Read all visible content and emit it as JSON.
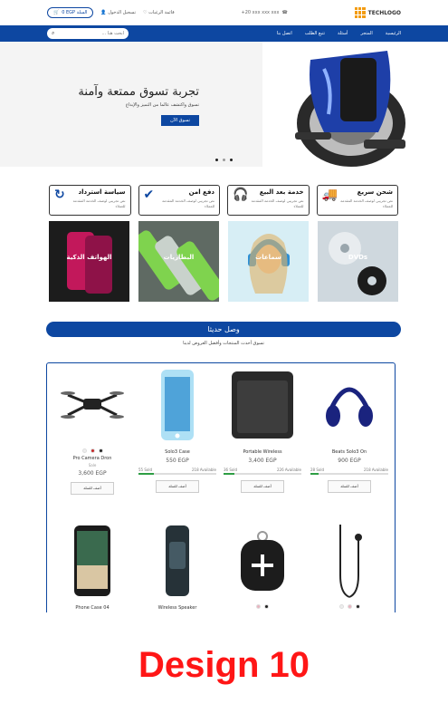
{
  "topbar": {
    "logo_text": "TECHLOGO",
    "contact": "+20 xxx xxx xxx",
    "wishlist": "قائمة الرغبات",
    "login": "تسجيل الدخول",
    "cart": "0 EGP السلة"
  },
  "nav": {
    "items": [
      {
        "label": "الرئيسية"
      },
      {
        "label": "المتجر"
      },
      {
        "label": "أسئلة"
      },
      {
        "label": "تتبع الطلب"
      },
      {
        "label": "اتصل بنا"
      }
    ],
    "search_placeholder": "ابحث هنا ..."
  },
  "hero": {
    "title": "تجربة تسوق ممتعة وآمنة",
    "subtitle": "تسوق واكتشف عالما من التميز والإبداع",
    "button": "تسوق الآن"
  },
  "features": [
    {
      "title": "شحن سريع",
      "desc": "نص تجريبي لوصف الخدمة المقدمة للعملاء"
    },
    {
      "title": "خدمة بعد البيع",
      "desc": "نص تجريبي لوصف الخدمة المقدمة للعملاء"
    },
    {
      "title": "دفع امن",
      "desc": "نص تجريبي لوصف الخدمة المقدمة للعملاء"
    },
    {
      "title": "سياسة استرداد",
      "desc": "نص تجريبي لوصف الخدمة المقدمة للعملاء"
    }
  ],
  "promos": [
    {
      "label": "الهواتف الذكية"
    },
    {
      "label": "البطاريات"
    },
    {
      "label": "سماعات"
    },
    {
      "label": "DVDs"
    }
  ],
  "section": {
    "title": "وصل حديثا",
    "subtitle": "تسوق أحدث المنتجات وأفضل العروض لدينا"
  },
  "products": [
    {
      "name": "Pro Camera Dron",
      "price": "3,600 EGP",
      "old": "Sale",
      "button": "أضف للسلة"
    },
    {
      "name": "Solo3 Case",
      "price": "550 EGP",
      "sold": "55 Sold",
      "available": "218 Available",
      "fill": 0.2,
      "button": "أضف للسلة"
    },
    {
      "name": "Portable Wireless",
      "price": "3,400 EGP",
      "sold": "36 Sold",
      "available": "226 Available",
      "fill": 0.14,
      "button": "أضف للسلة"
    },
    {
      "name": "Beats Solo3 On",
      "price": "900 EGP",
      "sold": "28 Sold",
      "available": "218 Available",
      "fill": 0.11,
      "button": "أضف للسلة"
    },
    {
      "name": "Phone Case 04",
      "price": ""
    },
    {
      "name": "Wireless Speaker",
      "price": ""
    },
    {
      "name": "",
      "price": ""
    },
    {
      "name": "",
      "price": ""
    }
  ],
  "design_label": "Design 10"
}
